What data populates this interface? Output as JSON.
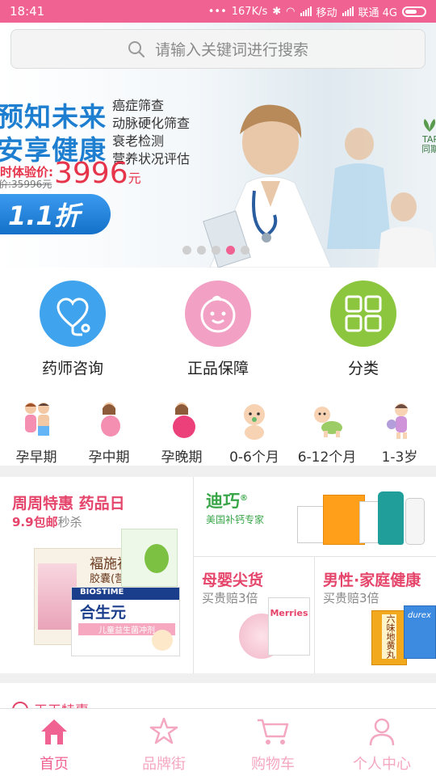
{
  "status_bar": {
    "time": "18:41",
    "network_speed": "167K/s",
    "carrier1": "移动",
    "carrier2": "联通 4G"
  },
  "search": {
    "placeholder": "请输入关键词进行搜索"
  },
  "banner": {
    "headline_1": "预知未来",
    "headline_2": "安享健康",
    "features": [
      "癌症筛查",
      "动脉硬化筛查",
      "衰老检测",
      "营养状况评估"
    ],
    "price_label": "时体验价:",
    "price": "3996",
    "price_unit": "元",
    "old_price": "价:35996元",
    "discount": "1.1折",
    "logo_text": "TAR\n同斯",
    "slide_count": 5,
    "active_slide": 4
  },
  "features_row": [
    {
      "label": "药师咨询",
      "icon": "stethoscope-icon",
      "color": "#3fa3ee"
    },
    {
      "label": "正品保障",
      "icon": "baby-face-icon",
      "color": "#f2a0c4"
    },
    {
      "label": "分类",
      "icon": "grid-icon",
      "color": "#8cc63f"
    }
  ],
  "stages": [
    {
      "label": "孕早期",
      "icon": "couple-icon"
    },
    {
      "label": "孕中期",
      "icon": "pregnant-icon"
    },
    {
      "label": "孕晚期",
      "icon": "pregnant-late-icon"
    },
    {
      "label": "0-6个月",
      "icon": "infant-icon"
    },
    {
      "label": "6-12个月",
      "icon": "crawling-baby-icon"
    },
    {
      "label": "1-3岁",
      "icon": "toddler-icon"
    }
  ],
  "promo": {
    "weekly": {
      "title": "周周特惠  药品日",
      "sub_highlight": "9.9包邮",
      "sub_rest": "秒杀",
      "product_brand": "BIOSTIME",
      "product_name": "合生元",
      "product_desc": "儿童益生菌冲剂",
      "box_top": "褔施福",
      "box_top_sub": "胶囊(营养"
    },
    "brand": {
      "name": "迪巧",
      "tagline": "美国补钙专家",
      "reg": "®"
    },
    "baby": {
      "title": "母婴尖货",
      "sub": "买贵赔3倍",
      "product": "Merries"
    },
    "family": {
      "title": "男性·家庭健康",
      "sub": "买贵赔3倍",
      "product": "durex",
      "box_label": "六味地黄丸"
    }
  },
  "next_section_label": "天天特惠",
  "tabs": [
    {
      "label": "首页",
      "icon": "home-icon",
      "active": true
    },
    {
      "label": "品牌街",
      "icon": "star-icon",
      "active": false
    },
    {
      "label": "购物车",
      "icon": "cart-icon",
      "active": false
    },
    {
      "label": "个人中心",
      "icon": "user-icon",
      "active": false
    }
  ],
  "colors": {
    "accent": "#f06292",
    "banner_blue": "#1e7fd0",
    "price_red": "#e6344a"
  }
}
